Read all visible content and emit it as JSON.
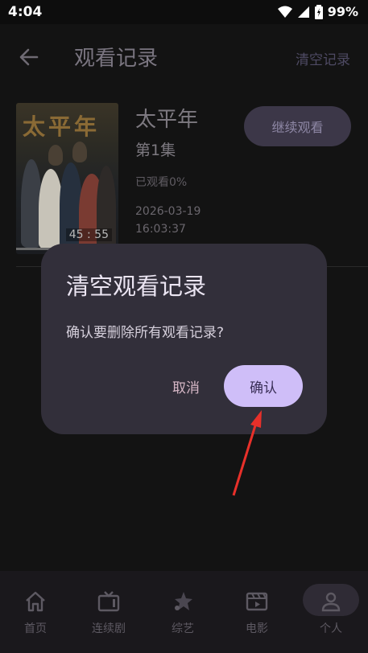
{
  "status_bar": {
    "time": "4:04",
    "battery": "99%"
  },
  "header": {
    "title": "观看记录",
    "clear_label": "清空记录"
  },
  "history": [
    {
      "title": "太平年",
      "episode": "第1集",
      "progress_text": "已观看0%",
      "progress_fraction": 0.0,
      "watch_date": "2026-03-19",
      "watch_time": "16:03:37",
      "poster_title": "太平年",
      "duration": "45 : 55",
      "continue_label": "继续观看"
    }
  ],
  "dialog": {
    "title": "清空观看记录",
    "message": "确认要删除所有观看记录?",
    "cancel_label": "取消",
    "confirm_label": "确认"
  },
  "bottom_nav": [
    {
      "label": "首页",
      "icon": "home-icon"
    },
    {
      "label": "连续剧",
      "icon": "tv-icon"
    },
    {
      "label": "综艺",
      "icon": "star-icon"
    },
    {
      "label": "电影",
      "icon": "film-icon"
    },
    {
      "label": "个人",
      "icon": "person-icon",
      "active": true
    }
  ],
  "colors": {
    "accent": "#cfbef8",
    "dialog_bg": "#322f3a",
    "annotation": "#e8302a"
  }
}
